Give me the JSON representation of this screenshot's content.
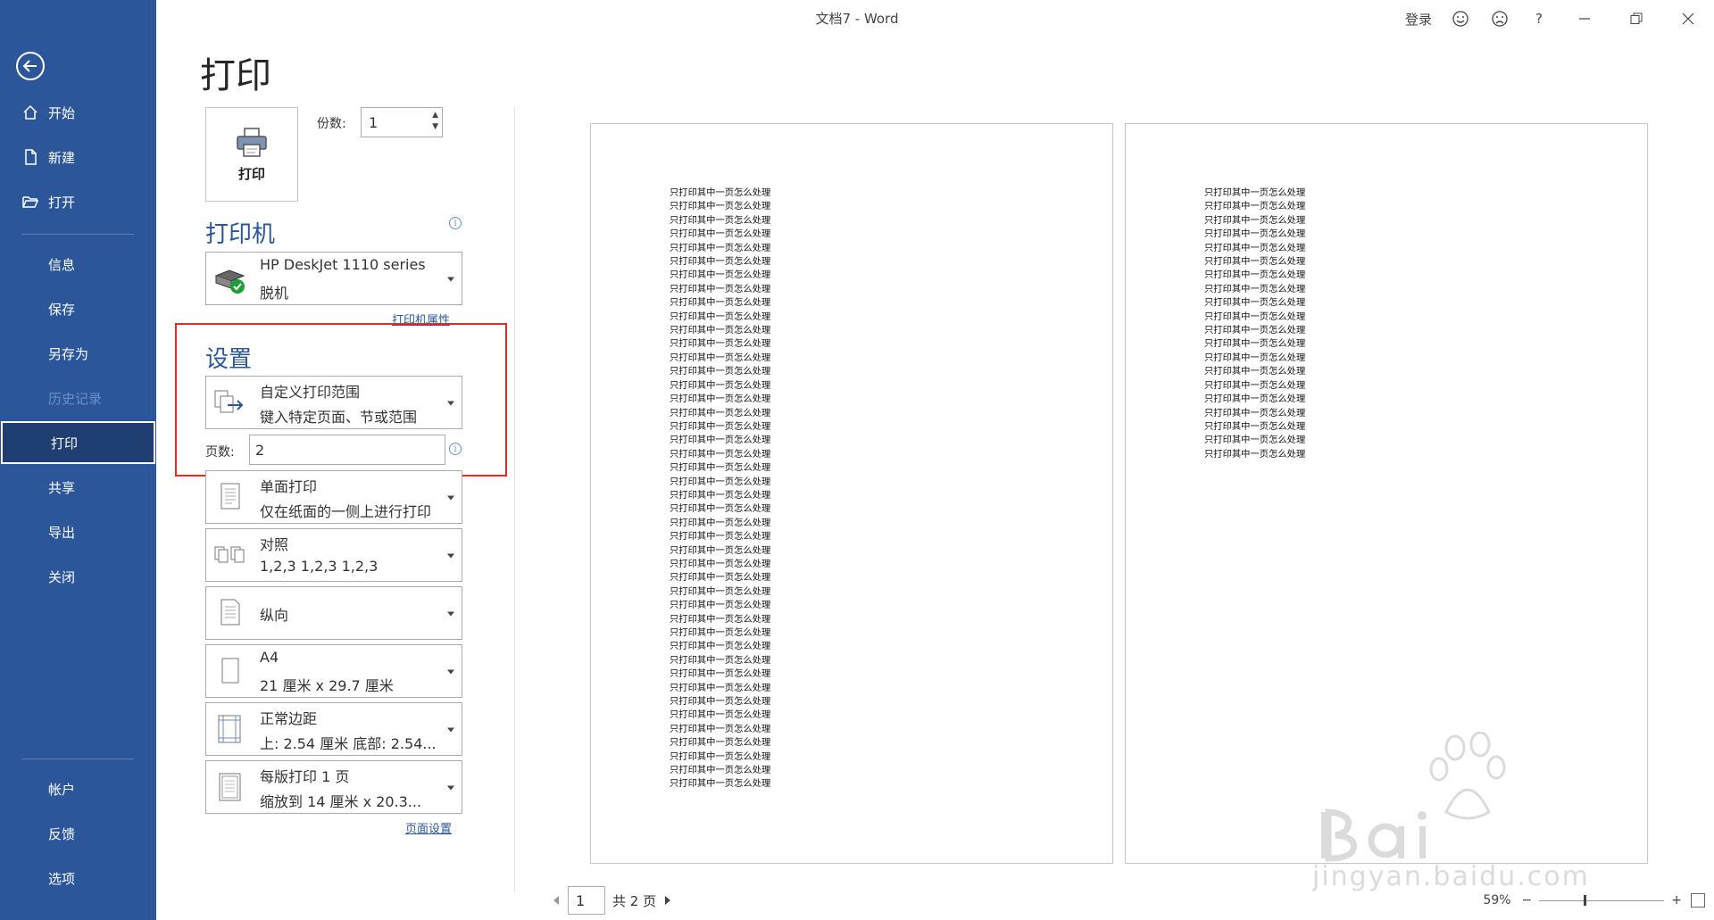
{
  "window": {
    "title": "文档7  -  Word",
    "signin": "登录",
    "help": "?"
  },
  "sidebar": {
    "items": [
      {
        "label": "开始"
      },
      {
        "label": "新建"
      },
      {
        "label": "打开"
      },
      {
        "label": "信息"
      },
      {
        "label": "保存"
      },
      {
        "label": "另存为"
      },
      {
        "label": "历史记录"
      },
      {
        "label": "打印"
      },
      {
        "label": "共享"
      },
      {
        "label": "导出"
      },
      {
        "label": "关闭"
      },
      {
        "label": "帐户"
      },
      {
        "label": "反馈"
      },
      {
        "label": "选项"
      }
    ]
  },
  "print": {
    "page_title": "打印",
    "print_button": "打印",
    "copies_label": "份数:",
    "copies_value": "1",
    "printer_section": "打印机",
    "printer_name": "HP DeskJet 1110 series",
    "printer_status": "脱机",
    "printer_properties": "打印机属性",
    "settings_section": "设置",
    "range_title": "自定义打印范围",
    "range_sub": "键入特定页面、节或范围",
    "pages_label": "页数:",
    "pages_value": "2",
    "sides_title": "单面打印",
    "sides_sub": "仅在纸面的一侧上进行打印",
    "collate_title": "对照",
    "collate_sub": "1,2,3    1,2,3    1,2,3",
    "orientation_title": "纵向",
    "paper_title": "A4",
    "paper_sub": "21 厘米 x 29.7 厘米",
    "margins_title": "正常边距",
    "margins_sub": "上: 2.54 厘米 底部: 2.54...",
    "pps_title": "每版打印 1 页",
    "pps_sub": "缩放到 14 厘米 x 20.3...",
    "page_setup": "页面设置"
  },
  "preview": {
    "line_text": "只打印其中一页怎么处理",
    "page1_lines": 44,
    "page2_lines": 20,
    "current_page": "1",
    "total_pages": "共 2 页",
    "zoom": "59%",
    "zoom_minus": "−",
    "zoom_plus": "+"
  },
  "colors": {
    "sidebar": "#2b579a",
    "accent": "#2b579a",
    "highlight": "#e02b2b"
  }
}
